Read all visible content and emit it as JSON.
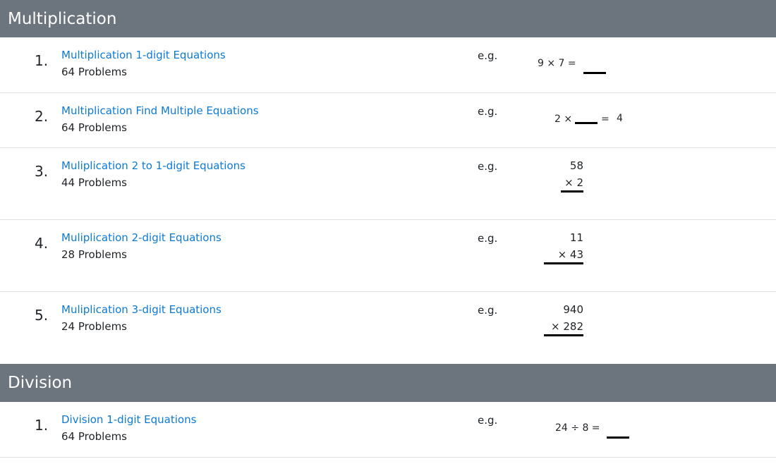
{
  "sections": [
    {
      "title": "Multiplication",
      "items": [
        {
          "num": "1.",
          "title": "Multiplication 1-digit Equations",
          "count": "64 Problems",
          "eg": "e.g.",
          "example": {
            "left": "9 × 7 ="
          }
        },
        {
          "num": "2.",
          "title": "Multiplication Find Multiple Equations",
          "count": "64 Problems",
          "eg": "e.g.",
          "example": {
            "left": "2 ×",
            "eq": "=",
            "result": "4"
          }
        },
        {
          "num": "3.",
          "title": "Muliplication 2 to 1-digit Equations",
          "count": "44 Problems",
          "eg": "e.g.",
          "example": {
            "top": "58",
            "bottom": "× 2"
          }
        },
        {
          "num": "4.",
          "title": "Muliplication 2-digit Equations",
          "count": "28 Problems",
          "eg": "e.g.",
          "example": {
            "top": "11",
            "bottom": "× 43"
          }
        },
        {
          "num": "5.",
          "title": "Muliplication 3-digit Equations",
          "count": "24 Problems",
          "eg": "e.g.",
          "example": {
            "top": "940",
            "bottom": "× 282"
          }
        }
      ]
    },
    {
      "title": "Division",
      "items": [
        {
          "num": "1.",
          "title": "Division 1-digit Equations",
          "count": "64 Problems",
          "eg": "e.g.",
          "example": {
            "left": "24 ÷ 8 ="
          }
        }
      ]
    }
  ],
  "colors": {
    "header_bg": "#6c757d",
    "link": "#0d7ad6",
    "divider": "#dee2e6"
  }
}
